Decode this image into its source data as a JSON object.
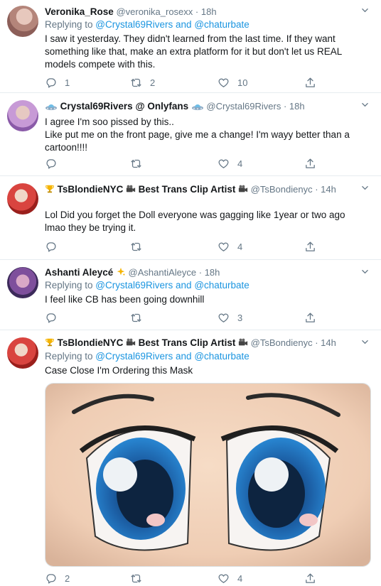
{
  "tweets": [
    {
      "name": "Veronika_Rose",
      "handle": "@veronika_rosexx",
      "time": "· 18h",
      "reply_prefix": "Replying to ",
      "reply_user1": "@Crystal69Rivers",
      "reply_and": " and ",
      "reply_user2": "@chaturbate",
      "body": "I saw it yesterday. They didn't learned from the last time. If they want something like that, make an extra platform for it but don't let us REAL models compete with this.",
      "replies": "1",
      "retweets": "2",
      "likes": "10",
      "avatar_color": "#c9a79a"
    },
    {
      "name": "Crystal69Rivers @ Onlyfans",
      "handle": "@Crystal69Rivers",
      "time": "· 18h",
      "body": "I agree I'm soo pissed by this..\nLike put me on the front page, give me a change! I'm wayy better than a cartoon!!!!",
      "replies": "",
      "retweets": "",
      "likes": "4",
      "avatar_color": "#b68cc4"
    },
    {
      "name": "TsBlondieNYC",
      "name_suffix": "Best Trans Clip Artist",
      "handle": "@TsBondienyc",
      "time": "· 14h",
      "body": "Lol Did you forget the Doll everyone was gagging like 1year or two ago lmao they be trying it.",
      "replies": "",
      "retweets": "",
      "likes": "4",
      "avatar_color": "#c0302d"
    },
    {
      "name": "Ashanti Aleycé",
      "handle": "@AshantiAleyce",
      "time": "· 18h",
      "reply_prefix": "Replying to ",
      "reply_user1": "@Crystal69Rivers",
      "reply_and": " and ",
      "reply_user2": "@chaturbate",
      "body": "I feel like CB has been going downhill",
      "replies": "",
      "retweets": "",
      "likes": "3",
      "avatar_color": "#6a4a8a"
    },
    {
      "name": "TsBlondieNYC",
      "name_suffix": "Best Trans Clip Artist",
      "handle": "@TsBondienyc",
      "time": "· 14h",
      "reply_prefix": "Replying to ",
      "reply_user1": "@Crystal69Rivers",
      "reply_and": " and ",
      "reply_user2": "@chaturbate",
      "body": "Case Close I'm Ordering this Mask",
      "replies": "2",
      "retweets": "",
      "likes": "4",
      "avatar_color": "#c0302d"
    }
  ],
  "colors": {
    "link": "#1b95e0",
    "muted": "#657786",
    "divider": "#e6ecf0"
  },
  "icons": [
    "reply-icon",
    "retweet-icon",
    "like-icon",
    "share-icon",
    "chevron-down-icon",
    "trophy-icon",
    "camera-icon",
    "ufo-icon",
    "sparkle-icon"
  ]
}
